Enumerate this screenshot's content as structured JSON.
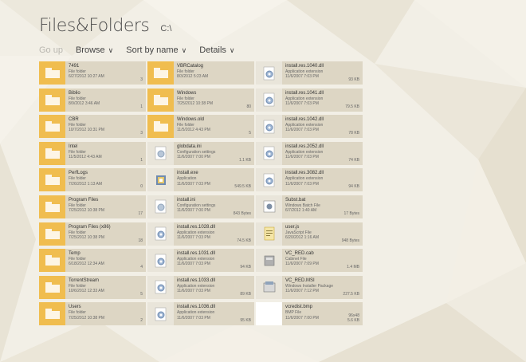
{
  "header": {
    "title": "Files&Folders",
    "path": "C:\\"
  },
  "toolbar": {
    "go_up": "Go up",
    "browse": "Browse",
    "sort": "Sort by name",
    "details": "Details"
  },
  "columns": [
    [
      {
        "name": "7491",
        "type": "File folder",
        "date": "6/27/2012 10:27 AM",
        "extra": "3",
        "icon": "folder-icon"
      },
      {
        "name": "Biblio",
        "type": "File folder",
        "date": "8/9/2012 3:46 AM",
        "extra": "1",
        "icon": "folder-icon"
      },
      {
        "name": "CBR",
        "type": "File folder",
        "date": "10/7/2012 10:31 PM",
        "extra": "3",
        "icon": "folder-icon"
      },
      {
        "name": "Intel",
        "type": "File folder",
        "date": "11/5/2012 4:43 AM",
        "extra": "1",
        "icon": "folder-icon"
      },
      {
        "name": "PerfLogs",
        "type": "File folder",
        "date": "7/26/2012 1:13 AM",
        "extra": "0",
        "icon": "folder-icon"
      },
      {
        "name": "Program Files",
        "type": "File folder",
        "date": "7/25/2012 10:38 PM",
        "extra": "17",
        "icon": "folder-icon"
      },
      {
        "name": "Program Files (x86)",
        "type": "File folder",
        "date": "7/25/2012 10:38 PM",
        "extra": "18",
        "icon": "folder-icon"
      },
      {
        "name": "Temp",
        "type": "File folder",
        "date": "6/18/2012 12:34 AM",
        "extra": "4",
        "icon": "folder-icon"
      },
      {
        "name": "TorrentStream",
        "type": "File folder",
        "date": "10/6/2012 12:33 AM",
        "extra": "5",
        "icon": "folder-icon"
      },
      {
        "name": "Users",
        "type": "File folder",
        "date": "7/25/2012 10:38 PM",
        "extra": "2",
        "icon": "folder-icon"
      }
    ],
    [
      {
        "name": "VBRCatalog",
        "type": "File folder",
        "date": "8/3/2012 5:23 AM",
        "extra": "",
        "icon": "folder-icon"
      },
      {
        "name": "Windows",
        "type": "File folder",
        "date": "7/25/2012 10:38 PM",
        "extra": "80",
        "icon": "folder-icon"
      },
      {
        "name": "Windows.old",
        "type": "File folder",
        "date": "11/5/2012 4:43 PM",
        "extra": "5",
        "icon": "folder-icon"
      },
      {
        "name": "globdata.ini",
        "type": "Configuration settings",
        "date": "11/6/2007 7:00 PM",
        "extra": "1.1 KB",
        "icon": "settings-file-icon"
      },
      {
        "name": "install.exe",
        "type": "Application",
        "date": "11/6/2007 7:03 PM",
        "extra": "549.5 KB",
        "icon": "setup-icon"
      },
      {
        "name": "install.ini",
        "type": "Configuration settings",
        "date": "11/6/2007 7:00 PM",
        "extra": "843 Bytes",
        "icon": "settings-file-icon"
      },
      {
        "name": "install.res.1028.dll",
        "type": "Application extension",
        "date": "11/6/2007 7:03 PM",
        "extra": "74.5 KB",
        "icon": "dll-gear-icon"
      },
      {
        "name": "install.res.1031.dll",
        "type": "Application extension",
        "date": "11/6/2007 7:03 PM",
        "extra": "94 KB",
        "icon": "dll-gear-icon"
      },
      {
        "name": "install.res.1033.dll",
        "type": "Application extension",
        "date": "11/6/2007 7:03 PM",
        "extra": "89 KB",
        "icon": "dll-gear-icon"
      },
      {
        "name": "install.res.1036.dll",
        "type": "Application extension",
        "date": "11/6/2007 7:03 PM",
        "extra": "95 KB",
        "icon": "dll-gear-icon"
      }
    ],
    [
      {
        "name": "install.res.1040.dll",
        "type": "Application extension",
        "date": "11/6/2007 7:03 PM",
        "extra": "93 KB",
        "icon": "dll-gear-icon"
      },
      {
        "name": "install.res.1041.dll",
        "type": "Application extension",
        "date": "11/6/2007 7:03 PM",
        "extra": "79.5 KB",
        "icon": "dll-gear-icon"
      },
      {
        "name": "install.res.1042.dll",
        "type": "Application extension",
        "date": "11/6/2007 7:03 PM",
        "extra": "78 KB",
        "icon": "dll-gear-icon"
      },
      {
        "name": "install.res.2052.dll",
        "type": "Application extension",
        "date": "11/6/2007 7:03 PM",
        "extra": "74 KB",
        "icon": "dll-gear-icon"
      },
      {
        "name": "install.res.3082.dll",
        "type": "Application extension",
        "date": "11/6/2007 7:03 PM",
        "extra": "94 KB",
        "icon": "dll-gear-icon"
      },
      {
        "name": "Subst.bat",
        "type": "Windows Batch File",
        "date": "6/7/2012 1:40 AM",
        "extra": "17 Bytes",
        "icon": "batch-file-icon"
      },
      {
        "name": "user.js",
        "type": "JavaScript File",
        "date": "6/20/2012 1:16 AM",
        "extra": "948 Bytes",
        "icon": "script-file-icon"
      },
      {
        "name": "VC_RED.cab",
        "type": "Cabinet File",
        "date": "11/6/2007 7:09 PM",
        "extra": "1.4 MB",
        "icon": "cabinet-icon"
      },
      {
        "name": "VC_RED.MSI",
        "type": "Windows Installer Package",
        "date": "11/6/2007 7:12 PM",
        "extra": "227.5 KB",
        "icon": "installer-icon"
      },
      {
        "name": "vcredist.bmp",
        "type": "BMP File",
        "date": "11/6/2007 7:00 PM",
        "extra": "96x48\n5.6 KB",
        "icon": "image-thumbnail"
      }
    ]
  ],
  "colors": {
    "background": "#f2efe6",
    "tile": "#ddd6c4",
    "folder": "#f0bd4f"
  }
}
